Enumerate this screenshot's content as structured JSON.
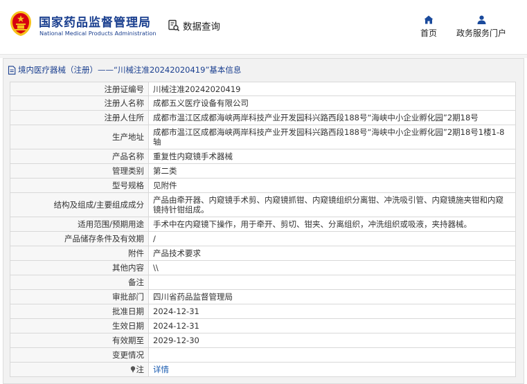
{
  "header": {
    "logo_cn": "国家药品监督管理局",
    "logo_en": "National Medical Products Administration",
    "query_label": "数据查询",
    "nav": [
      {
        "label": "首页",
        "icon": "home-icon"
      },
      {
        "label": "政务服务门户",
        "icon": "user-icon"
      }
    ]
  },
  "panel": {
    "title": "境内医疗器械（注册）——“川械注准20242020419”基本信息"
  },
  "rows": [
    {
      "key": "注册证编号",
      "value": "川械注准20242020419"
    },
    {
      "key": "注册人名称",
      "value": "成都五义医疗设备有限公司"
    },
    {
      "key": "注册人住所",
      "value": "成都市温江区成都海峡两岸科技产业开发园科兴路西段188号“海峡中小企业孵化园”2期18号"
    },
    {
      "key": "生产地址",
      "value": "成都市温江区成都海峡两岸科技产业开发园科兴路西段188号“海峡中小企业孵化园”2期18号1楼1-8轴"
    },
    {
      "key": "产品名称",
      "value": "重复性内窥镜手术器械"
    },
    {
      "key": "管理类别",
      "value": "第二类"
    },
    {
      "key": "型号规格",
      "value": "见附件"
    },
    {
      "key": "结构及组成/主要组成成分",
      "value": "产品由牵开器、内窥镜手术剪、内窥镜抓钳、内窥镜组织分离钳、冲洗吸引管、内窥镜施夹钳和内窥镜持针钳组成。"
    },
    {
      "key": "适用范围/预期用途",
      "value": "手术中在内窥镜下操作，用于牵开、剪切、钳夹、分离组织，冲洗组织或吸液，夹持器械。"
    },
    {
      "key": "产品储存条件及有效期",
      "value": "/"
    },
    {
      "key": "附件",
      "value": "产品技术要求"
    },
    {
      "key": "其他内容",
      "value": "\\\\"
    },
    {
      "key": "备注",
      "value": ""
    },
    {
      "key": "审批部门",
      "value": "四川省药品监督管理局"
    },
    {
      "key": "批准日期",
      "value": "2024-12-31"
    },
    {
      "key": "生效日期",
      "value": "2024-12-31"
    },
    {
      "key": "有效期至",
      "value": "2029-12-30"
    },
    {
      "key": "变更情况",
      "value": ""
    },
    {
      "key": "注",
      "value": "详情"
    }
  ],
  "colors": {
    "brand_blue": "#1a3f8f",
    "link_blue": "#1a5bb0",
    "emblem_red": "#d7000f",
    "emblem_gold": "#f6c21c"
  }
}
